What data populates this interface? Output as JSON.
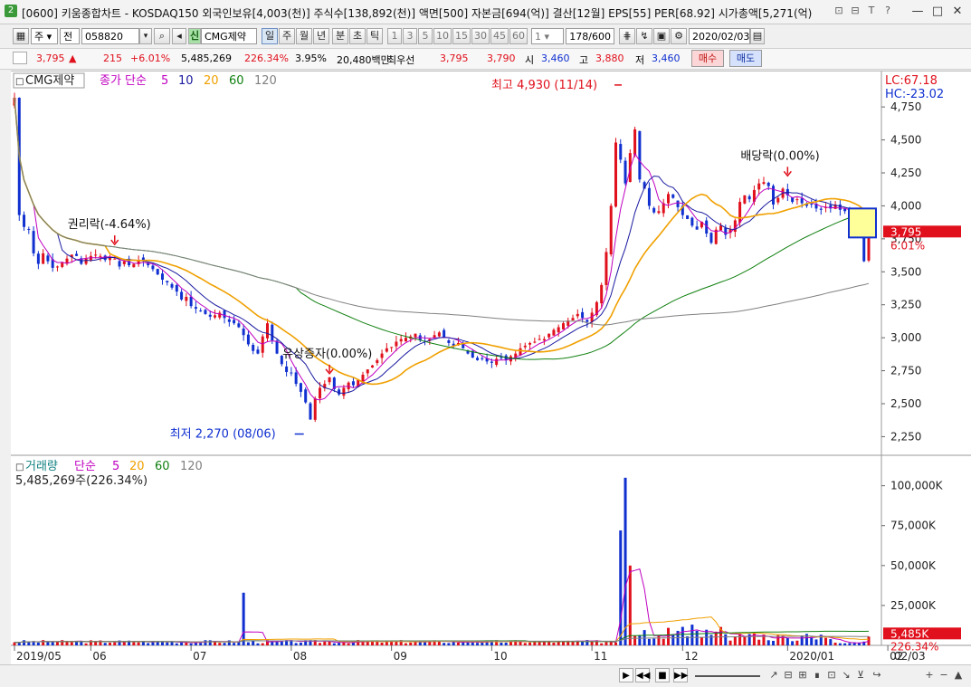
{
  "window": {
    "title": "[0600] 키움종합차트 - KOSDAQ150 외국인보유[4,003(천)] 주식수[138,892(천)] 액면[500] 자본금[694(억)] 결산[12월] EPS[55] PER[68.92] 시가총액[5,271(억)",
    "app_badge": "2",
    "title_icons": [
      "link-icon",
      "print-icon",
      "text-icon",
      "help-icon"
    ],
    "title_icon_glyphs": [
      "⊡",
      "⊟",
      "T",
      "?"
    ],
    "controls": [
      "minimize",
      "maximize",
      "close"
    ],
    "control_glyphs": [
      "—",
      "□",
      "✕"
    ]
  },
  "toolbar": {
    "period_type": "주",
    "market": "전",
    "code": "058820",
    "stock_name": "CMG제약",
    "credit_badge": "신",
    "intervals": [
      "일",
      "주",
      "월",
      "년",
      "분",
      "초",
      "틱"
    ],
    "active_interval": "일",
    "minute_options": [
      "1",
      "3",
      "5",
      "10",
      "15",
      "30",
      "45",
      "60"
    ],
    "count_select": "1",
    "page_counter": "178/600",
    "date": "2020/02/03"
  },
  "quote": {
    "price": "3,795",
    "arrow": "▲",
    "change": "215",
    "change_pct": "+6.01%",
    "volume": "5,485,269",
    "volume_ratio": "226.34%",
    "turnover": "3.95%",
    "amount": "20,480백만",
    "best_ask_label": "최우선",
    "best_ask": "3,795",
    "best_bid": "3,790",
    "open_label": "시",
    "open": "3,460",
    "high_label": "고",
    "high": "3,880",
    "low_label": "저",
    "low": "3,460",
    "buy_label": "매수",
    "sell_label": "매도"
  },
  "chart_data": [
    {
      "type": "candlestick",
      "title": "CMG제약",
      "legend_prefix": "종가 단순",
      "ma_periods": [
        "5",
        "10",
        "20",
        "60",
        "120"
      ],
      "ma_colors": [
        "#c000c0",
        "#1a1aa0",
        "#f0a000",
        "#108010",
        "#808080"
      ],
      "corner_labels": [
        "LC:67.18",
        "HC:-23.02"
      ],
      "y_ticks": [
        2250,
        2500,
        2750,
        3000,
        3250,
        3500,
        3750,
        4000,
        4250,
        4500,
        4750
      ],
      "y_tick_labels": [
        "2,250",
        "2,500",
        "2,750",
        "3,000",
        "3,250",
        "3,500",
        "3,750",
        "4,000",
        "4,250",
        "4,500",
        "4,750"
      ],
      "ylim": [
        2150,
        4950
      ],
      "x_ticks": [
        "2019/05",
        "06",
        "07",
        "08",
        "09",
        "10",
        "11",
        "12",
        "2020/01",
        "02"
      ],
      "x_tick_days": [
        0,
        16,
        37,
        58,
        79,
        100,
        121,
        140,
        162,
        183
      ],
      "current_price_label": "3,795",
      "current_pct_label": "6.01%",
      "annotations": [
        {
          "text": "최고 4,930 (11/14)",
          "day": 128,
          "value": 4930,
          "color": "#e0101c"
        },
        {
          "text": "최저 2,270 (08/06)",
          "day": 61,
          "value": 2270,
          "color": "#1030d0"
        },
        {
          "text": "권리락(-4.64%)",
          "day": 21,
          "value": 3680,
          "color": "#e0101c"
        },
        {
          "text": "유상증자(0.00%)",
          "day": 66,
          "value": 2700,
          "color": "#e0101c"
        },
        {
          "text": "배당락(0.00%)",
          "day": 162,
          "value": 4200,
          "color": "#e0101c"
        }
      ],
      "closes": [
        4820,
        3930,
        3840,
        3820,
        3640,
        3560,
        3640,
        3580,
        3530,
        3540,
        3570,
        3600,
        3630,
        3620,
        3560,
        3600,
        3620,
        3630,
        3620,
        3590,
        3610,
        3600,
        3540,
        3580,
        3550,
        3560,
        3590,
        3580,
        3550,
        3520,
        3480,
        3440,
        3420,
        3380,
        3350,
        3290,
        3310,
        3240,
        3220,
        3200,
        3180,
        3160,
        3170,
        3190,
        3150,
        3120,
        3110,
        3080,
        3020,
        2950,
        2900,
        2880,
        3010,
        3110,
        2980,
        2880,
        2800,
        2740,
        2730,
        2650,
        2590,
        2510,
        2380,
        2540,
        2620,
        2650,
        2700,
        2610,
        2570,
        2620,
        2660,
        2640,
        2680,
        2720,
        2760,
        2790,
        2830,
        2880,
        2920,
        2930,
        2970,
        2990,
        3000,
        3010,
        3030,
        2980,
        2970,
        2990,
        3020,
        3040,
        3000,
        2960,
        2940,
        2960,
        2920,
        2880,
        2850,
        2830,
        2840,
        2820,
        2810,
        2840,
        2850,
        2830,
        2860,
        2880,
        2920,
        2940,
        2960,
        2970,
        2990,
        2990,
        3030,
        3060,
        3080,
        3110,
        3130,
        3150,
        3180,
        3150,
        3120,
        3190,
        3270,
        3400,
        3650,
        4000,
        4480,
        4350,
        4170,
        4400,
        4580,
        4200,
        4130,
        4000,
        3950,
        3960,
        4020,
        4090,
        4060,
        3990,
        3930,
        3900,
        3850,
        3820,
        3880,
        3790,
        3720,
        3820,
        3850,
        3780,
        3820,
        3890,
        4030,
        4080,
        4050,
        4120,
        4170,
        4180,
        4150,
        4010,
        4060,
        4130,
        4080,
        4030,
        4050,
        4020,
        4000,
        4010,
        3980,
        3970,
        3990,
        3980,
        4010,
        3970,
        3960,
        3930,
        3870,
        3800,
        3580,
        3795
      ]
    },
    {
      "type": "bar",
      "title": "거래량",
      "legend_prefix": "단순",
      "ma_periods": [
        "5",
        "20",
        "60",
        "120"
      ],
      "ma_colors": [
        "#c000c0",
        "#f0a000",
        "#108010",
        "#808080"
      ],
      "current_label": "5,485,269주(226.34%)",
      "y_ticks": [
        25000,
        50000,
        75000,
        100000
      ],
      "y_tick_labels": [
        "25,000K",
        "50,000K",
        "75,000K",
        "100,000K"
      ],
      "ylim": [
        0,
        110000
      ],
      "last_volume_label": "5,485K",
      "last_ratio_label": "226.34%",
      "spike_days": [
        48,
        127,
        128,
        129
      ],
      "spike_values": [
        33000,
        72000,
        105000,
        50000
      ]
    }
  ],
  "bottom": {
    "date_stub": "02/03",
    "nav_buttons": [
      "▶",
      "◀◀",
      "■",
      "▶▶"
    ],
    "tools": [
      "↗",
      "⊟",
      "⊞",
      "∎",
      "⊡",
      "↘",
      "⊻",
      "↪",
      "+",
      "−",
      "▲"
    ]
  }
}
